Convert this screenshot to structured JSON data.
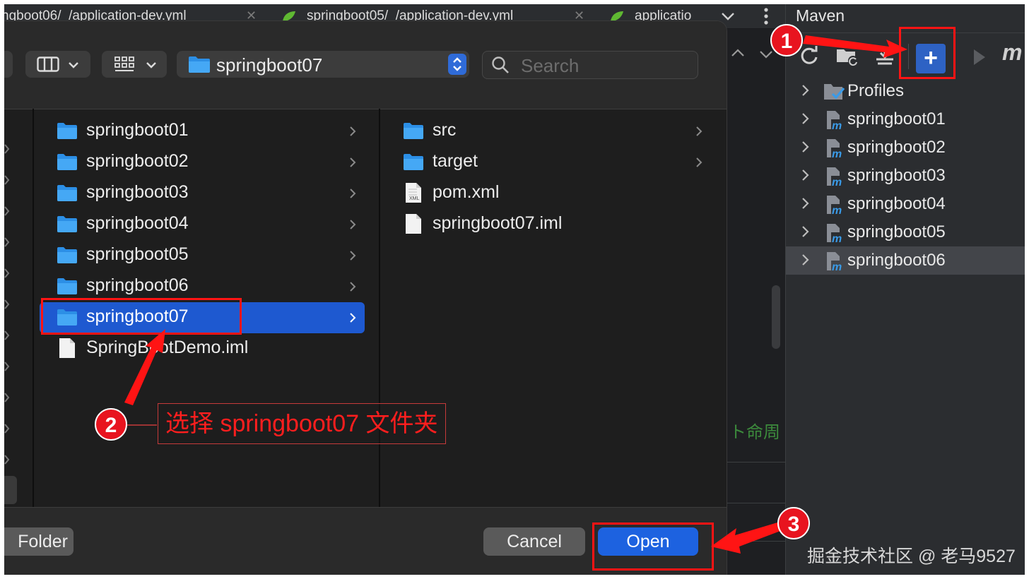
{
  "editor_tabs": [
    {
      "label": "ngboot06/_/application-dev.yml"
    },
    {
      "label": "springboot05/_/application-dev.yml"
    },
    {
      "label": "applicatio"
    }
  ],
  "maven": {
    "title": "Maven",
    "tree": [
      {
        "label": "Profiles"
      },
      {
        "label": "springboot01"
      },
      {
        "label": "springboot02"
      },
      {
        "label": "springboot03"
      },
      {
        "label": "springboot04"
      },
      {
        "label": "springboot05"
      },
      {
        "label": "springboot06"
      }
    ],
    "m_label": "m",
    "add_symbol": "+",
    "obscured_text": "ト命周"
  },
  "dialog": {
    "path": "springboot07",
    "search_placeholder": "Search",
    "column1": [
      {
        "label": "springboot01",
        "type": "folder",
        "has_children": true
      },
      {
        "label": "springboot02",
        "type": "folder",
        "has_children": true
      },
      {
        "label": "springboot03",
        "type": "folder",
        "has_children": true
      },
      {
        "label": "springboot04",
        "type": "folder",
        "has_children": true
      },
      {
        "label": "springboot05",
        "type": "folder",
        "has_children": true
      },
      {
        "label": "springboot06",
        "type": "folder",
        "has_children": true
      },
      {
        "label": "springboot07",
        "type": "folder",
        "has_children": true,
        "selected": true
      },
      {
        "label": "SpringBootDemo.iml",
        "type": "file",
        "has_children": false
      }
    ],
    "column2": [
      {
        "label": "src",
        "type": "folder",
        "has_children": true
      },
      {
        "label": "target",
        "type": "folder",
        "has_children": true
      },
      {
        "label": "pom.xml",
        "type": "xml",
        "has_children": false
      },
      {
        "label": "springboot07.iml",
        "type": "file",
        "has_children": false
      }
    ],
    "new_folder_label": "Folder",
    "cancel_label": "Cancel",
    "open_label": "Open",
    "xml_badge": "XML"
  },
  "annotations": {
    "badge1": "1",
    "badge2": "2",
    "badge3": "3",
    "callout_text": "选择 springboot07 文件夹",
    "color": "#ff1414"
  },
  "watermark": "掘金技术社区 @ 老马9527"
}
